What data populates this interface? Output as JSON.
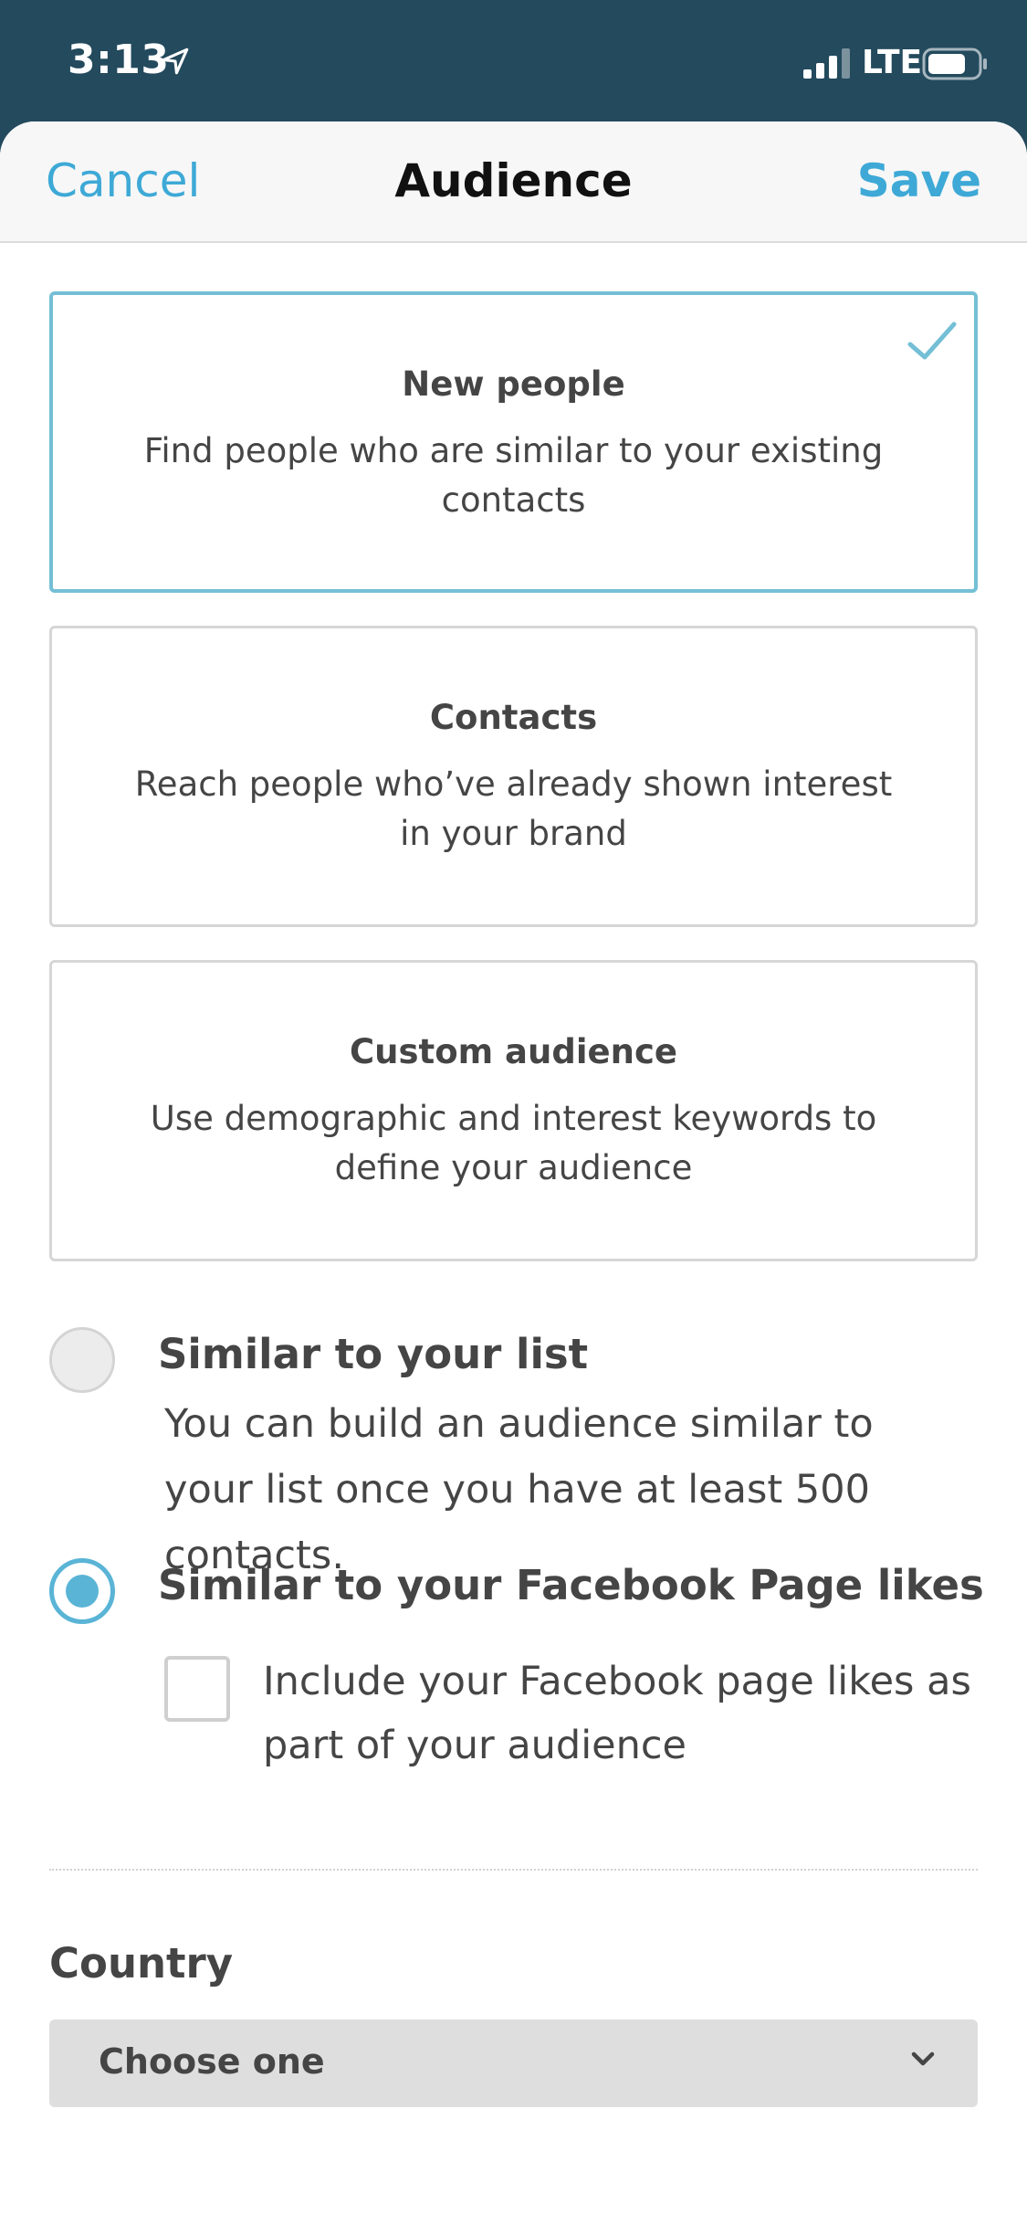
{
  "status_bar": {
    "time": "3:13",
    "network": "LTE"
  },
  "nav": {
    "cancel": "Cancel",
    "title": "Audience",
    "save": "Save"
  },
  "options": [
    {
      "title": "New people",
      "description": "Find people who are similar to your existing contacts",
      "selected": true
    },
    {
      "title": "Contacts",
      "description": "Reach people who’ve already shown interest in your brand",
      "selected": false
    },
    {
      "title": "Custom audience",
      "description": "Use demographic and interest keywords to define your audience",
      "selected": false
    }
  ],
  "similar_list": {
    "label": "Similar to your list",
    "help": "You can build an audience similar to your list once you have at least 500 contacts.",
    "selected": false
  },
  "similar_facebook": {
    "label": "Similar to your Facebook Page likes",
    "selected": true,
    "checkbox_label": "Include your Facebook page likes as part of your audience",
    "checkbox_checked": false
  },
  "country": {
    "label": "Country",
    "value": "Choose one"
  },
  "colors": {
    "accent": "#3ea9d6",
    "status_bar": "#234a5d",
    "selected_border": "#74bfd6"
  },
  "icons": [
    "location-arrow-icon",
    "signal-icon",
    "battery-icon",
    "checkmark-icon",
    "chevron-down-icon"
  ]
}
